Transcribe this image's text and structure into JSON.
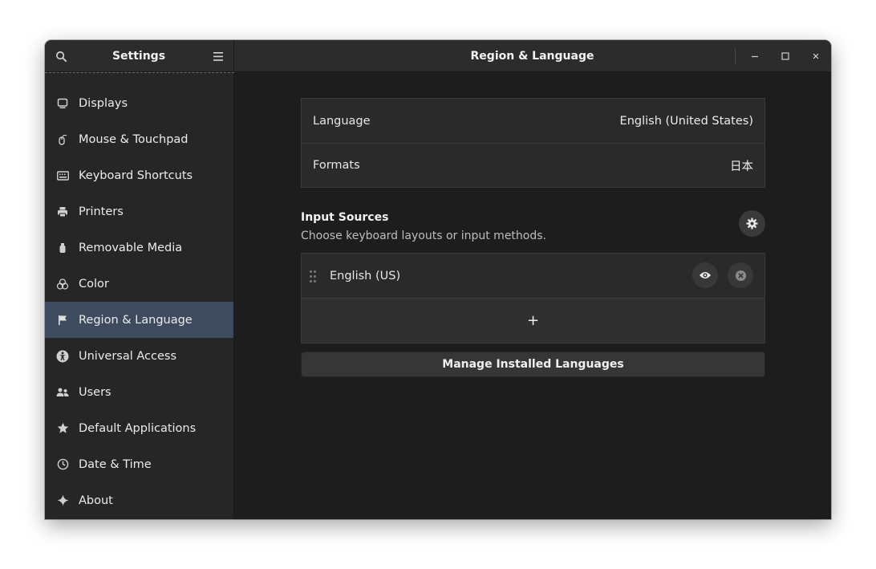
{
  "app_title": "Settings",
  "page_title": "Region & Language",
  "sidebar": {
    "items": [
      {
        "label": "Displays",
        "icon": "display-icon",
        "active": false
      },
      {
        "label": "Mouse & Touchpad",
        "icon": "mouse-icon",
        "active": false
      },
      {
        "label": "Keyboard Shortcuts",
        "icon": "keyboard-icon",
        "active": false
      },
      {
        "label": "Printers",
        "icon": "printer-icon",
        "active": false
      },
      {
        "label": "Removable Media",
        "icon": "usb-drive-icon",
        "active": false
      },
      {
        "label": "Color",
        "icon": "color-icon",
        "active": false
      },
      {
        "label": "Region & Language",
        "icon": "flag-icon",
        "active": true
      },
      {
        "label": "Universal Access",
        "icon": "accessibility-icon",
        "active": false
      },
      {
        "label": "Users",
        "icon": "users-icon",
        "active": false
      },
      {
        "label": "Default Applications",
        "icon": "star-icon",
        "active": false
      },
      {
        "label": "Date & Time",
        "icon": "clock-icon",
        "active": false
      },
      {
        "label": "About",
        "icon": "sparkle-icon",
        "active": false
      }
    ]
  },
  "region": {
    "language_label": "Language",
    "language_value": "English (United States)",
    "formats_label": "Formats",
    "formats_value": "日本"
  },
  "input_sources": {
    "title": "Input Sources",
    "subtitle": "Choose keyboard layouts or input methods.",
    "sources": [
      {
        "name": "English (US)"
      }
    ],
    "add_label": "+"
  },
  "manage_button_label": "Manage Installed Languages",
  "colors": {
    "active_sidebar": "#3e4b5e",
    "window_bg": "#1d1d1d",
    "header_bg": "#2c2c2c"
  }
}
